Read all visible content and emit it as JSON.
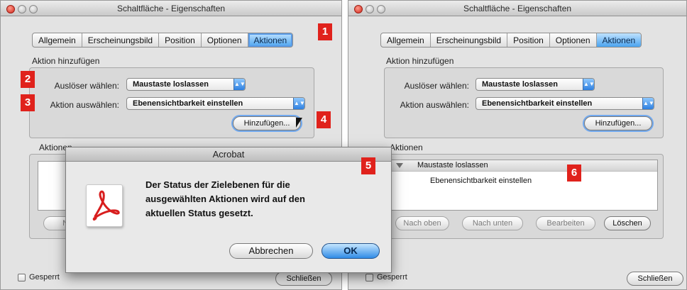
{
  "windows": [
    {
      "title": "Schaltfläche - Eigenschaften",
      "tabs": [
        {
          "label": "Allgemein",
          "active": false
        },
        {
          "label": "Erscheinungsbild",
          "active": false
        },
        {
          "label": "Position",
          "active": false
        },
        {
          "label": "Optionen",
          "active": false
        },
        {
          "label": "Aktionen",
          "active": true
        }
      ],
      "add_action_group": "Aktion hinzufügen",
      "trigger_label": "Auslöser wählen:",
      "trigger_value": "Maustaste loslassen",
      "action_label": "Aktion auswählen:",
      "action_value": "Ebenensichtbarkeit einstellen",
      "add_button": "Hinzufügen...",
      "actions_group": "Aktionen",
      "action_buttons": {
        "up": "Nach",
        "down": "",
        "edit": "",
        "delete": ""
      },
      "locked_label": "Gesperrt",
      "close_button": "Schließen"
    },
    {
      "title": "Schaltfläche - Eigenschaften",
      "tabs": [
        {
          "label": "Allgemein",
          "active": false
        },
        {
          "label": "Erscheinungsbild",
          "active": false
        },
        {
          "label": "Position",
          "active": false
        },
        {
          "label": "Optionen",
          "active": false
        },
        {
          "label": "Aktionen",
          "active": true
        }
      ],
      "add_action_group": "Aktion hinzufügen",
      "trigger_label": "Auslöser wählen:",
      "trigger_value": "Maustaste loslassen",
      "action_label": "Aktion auswählen:",
      "action_value": "Ebenensichtbarkeit einstellen",
      "add_button": "Hinzufügen...",
      "actions_group": "Aktionen",
      "actions_list": {
        "trigger": "Maustaste loslassen",
        "action": "Ebenensichtbarkeit einstellen"
      },
      "action_buttons": {
        "up": "Nach oben",
        "down": "Nach unten",
        "edit": "Bearbeiten",
        "delete": "Löschen"
      },
      "locked_label": "Gesperrt",
      "close_button": "Schließen"
    }
  ],
  "dialog": {
    "title": "Acrobat",
    "message_lines": [
      "Der Status der Zielebenen für die",
      "ausgewählten Aktionen wird auf den",
      "aktuellen Status gesetzt."
    ],
    "cancel": "Abbrechen",
    "ok": "OK"
  },
  "callouts": [
    "1",
    "2",
    "3",
    "4",
    "5",
    "6"
  ],
  "colors": {
    "callout": "#e0221c",
    "accent": "#2f8be6"
  },
  "icons": {
    "popup": "popup-arrows-icon",
    "app": "acrobat-icon",
    "pointer": "mouse-cursor-icon"
  }
}
